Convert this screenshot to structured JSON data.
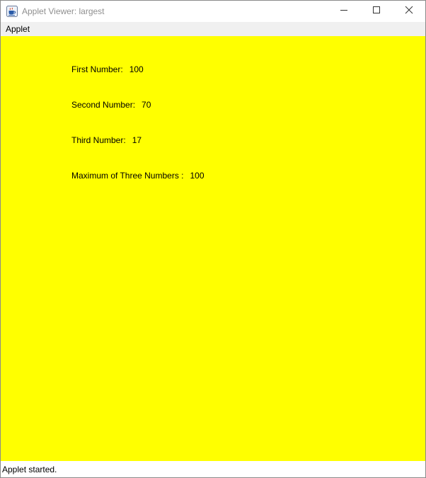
{
  "window": {
    "title": "Applet Viewer: largest",
    "app_icon": "java-coffee-cup-icon",
    "controls": [
      "minimize-icon",
      "maximize-icon",
      "close-icon"
    ]
  },
  "menubar": {
    "items": [
      {
        "label": "Applet"
      }
    ]
  },
  "applet": {
    "background_color": "#ffff00",
    "text_color": "#000000",
    "lines": [
      {
        "label": "First Number:",
        "value": "100"
      },
      {
        "label": "Second Number:",
        "value": "70"
      },
      {
        "label": "Third Number:",
        "value": "17"
      },
      {
        "label": "Maximum of Three Numbers :",
        "value": "100"
      }
    ]
  },
  "status": {
    "text": "Applet started."
  }
}
